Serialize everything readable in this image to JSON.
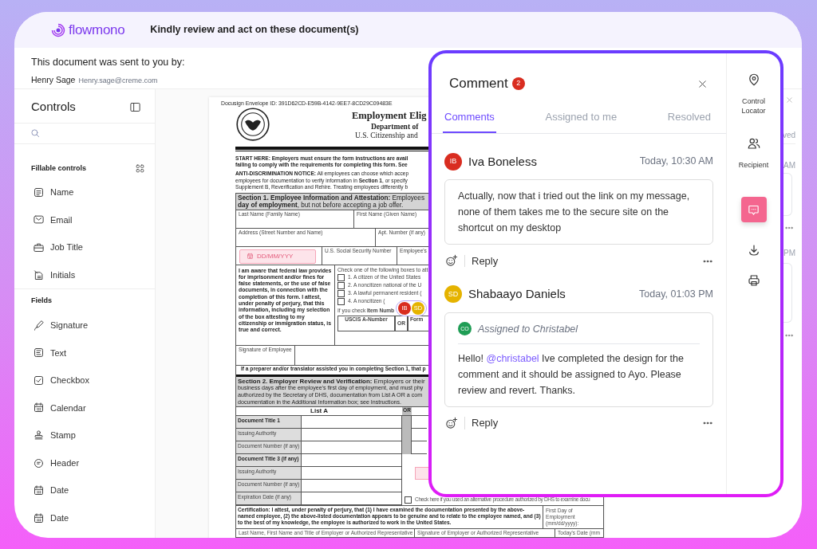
{
  "header": {
    "brand": "flowmono",
    "title": "Kindly review and act on these document(s)"
  },
  "sender": {
    "intro": "This document was sent to you by:",
    "name": "Henry Sage",
    "email": "Henry.sage@creme.com"
  },
  "sidebar": {
    "title": "Controls",
    "groups": [
      {
        "heading": "Fillable controls",
        "items": [
          {
            "label": "Name",
            "kind": "name"
          },
          {
            "label": "Email",
            "kind": "email"
          },
          {
            "label": "Job Title",
            "kind": "job"
          },
          {
            "label": "Initials",
            "kind": "initials"
          }
        ]
      },
      {
        "heading": "Fields",
        "items": [
          {
            "label": "Signature",
            "kind": "signature"
          },
          {
            "label": "Text",
            "kind": "text"
          },
          {
            "label": "Checkbox",
            "kind": "checkbox"
          },
          {
            "label": "Calendar",
            "kind": "calendar"
          },
          {
            "label": "Stamp",
            "kind": "stamp"
          },
          {
            "label": "Header",
            "kind": "header"
          },
          {
            "label": "Date",
            "kind": "date"
          },
          {
            "label": "Date",
            "kind": "date"
          }
        ]
      }
    ]
  },
  "document": {
    "envelope_id": "Docusign Envelope ID: 391D62CD-E59B-4142-9EE7-8CD29C09483E",
    "title": "Employment Elig",
    "department": "Department of",
    "agency": "U.S. Citizenship and",
    "start_lines": [
      "START HERE:  Employers must ensure the form instructions are avail",
      "failing to comply with the requirements for completing this form.  See"
    ],
    "notice_lines": [
      "**ANTI-DISCRIMINATION NOTICE:**  All employees can choose which accep",
      "employees for documentation to verify information in **Section 1**, or specify",
      "Supplement B, Reverification and Rehire.  Treating employees differently b"
    ],
    "section1_lines": [
      "**Section 1. Employee Information and Attestation:** Employees",
      "**day of employment**, but not before accepting a job offer."
    ],
    "name_fields": [
      "Last Name (Family Name)",
      "First Name (Given Name)"
    ],
    "address_fields": [
      "Address (Street Number and Name)",
      "Apt. Number (if any)"
    ],
    "date_field": {
      "placeholder": "DD/MM/YYY"
    },
    "ssn_label": "U.S. Social Security Number",
    "employee_label": "Employee's",
    "attestation": "I am aware that federal law provides for imprisonment and/or fines for false statements, or the use of false documents, in connection with the completion of this form.  I attest, under penalty of perjury, that this information, including my selection of the box attesting to my citizenship or immigration status, is true and correct.",
    "status_prompt": "Check one of the following boxes to att",
    "status_options": [
      {
        "label": "1.  A citizen of the United States",
        "checked": false
      },
      {
        "label": "2.  A noncitizen national of the U",
        "checked": false
      },
      {
        "label": "3.  A lawful permanent resident (",
        "checked": false
      },
      {
        "label": "4.  A noncitizen (",
        "checked": false
      }
    ],
    "item_note": "If you check **Item Numb**",
    "uscis_label": "USCIS A-Number",
    "or_label": "OR",
    "form_label": "Form",
    "markers": [
      {
        "initials": "IB",
        "color": "#d92d20"
      },
      {
        "initials": "SD",
        "color": "#e5b300"
      }
    ],
    "signature_label": "Signature of Employee",
    "preparer_note": "If a preparer and/or translator assisted you in completing Section 1, that p",
    "section2_lines": [
      "**Section 2. Employer Review and Verification:** Employers or their",
      "business days after the employee's first day of employment, and must phy",
      "authorized by the Secretary of DHS, documentation from List A OR a com",
      "documentation in the Additional Information box; see Instructions."
    ],
    "list_heading": "List A",
    "list_or": "OR",
    "list_rows": [
      {
        "label": "Document Title 1",
        "kind": "title"
      },
      {
        "label": "Issuing Authority",
        "kind": "detail"
      },
      {
        "label": "Document Number (if any)",
        "kind": "detail"
      },
      {
        "label": "Document Title 3 (if any)",
        "kind": "title"
      },
      {
        "label": "Issuing Authority",
        "kind": "detail"
      },
      {
        "label": "Document Number (if any)",
        "kind": "detail"
      },
      {
        "label": "Expiration Date (if any)",
        "kind": "detail"
      }
    ],
    "alt_procedure": {
      "label": "Check here if you used an alternative procedure authorized by DHS to examine docu",
      "checked": false
    },
    "certification": "Certification:  I attest, under penalty of perjury, that (1) I have examined the documentation presented by the above-named employee, (2) the above-listed documentation appears to be genuine and to relate to the employee named, and (3) to the best of my knowledge, the employee is authorized to work in the United States.",
    "first_day": "First Day of Employment (mm/dd/yyyy):",
    "footer_labels": [
      "Last Name, First Name and Title of Employer or Authorized Representative",
      "Signature of Employer or Authorized Representative",
      "Today's Date (mm"
    ]
  },
  "background_panel": {
    "tab_fragment": "ved",
    "times": [
      "AM",
      "PM"
    ]
  },
  "comment_panel": {
    "title": "Comment",
    "count": "2",
    "tabs": [
      {
        "label": "Comments",
        "selected": true
      },
      {
        "label": "Assigned to me",
        "selected": false
      },
      {
        "label": "Resolved",
        "selected": false
      }
    ],
    "comments": [
      {
        "initials": "IB",
        "color": "#d92d20",
        "author": "Iva Boneless",
        "time": "Today, 10:30 AM",
        "body_parts": [
          {
            "kind": "text",
            "text": "Actually, now that i tried out the link on my message, none of them takes me to the secure site on the shortcut on my desktop"
          }
        ],
        "reply": "Reply"
      },
      {
        "initials": "SD",
        "color": "#e5b300",
        "author": "Shabaayo Daniels",
        "time": "Today, 01:03 PM",
        "assignment": {
          "initials": "CO",
          "color": "#1f9d55",
          "text": "Assigned to Christabel"
        },
        "body_parts": [
          {
            "kind": "text",
            "text": "Hello! "
          },
          {
            "kind": "mention",
            "text": "@christabel"
          },
          {
            "kind": "text",
            "text": " Ive completed the design for the comment and it should be assigned to Ayo. Please review and revert. Thanks."
          }
        ],
        "reply": "Reply"
      }
    ]
  },
  "tools": [
    {
      "label": "Control Locator",
      "kind": "locator",
      "selected": false
    },
    {
      "label": "Recipient",
      "kind": "recipient",
      "selected": false
    },
    {
      "kind": "comment",
      "selected": true
    },
    {
      "kind": "download",
      "selected": false
    },
    {
      "kind": "print",
      "selected": false
    }
  ]
}
